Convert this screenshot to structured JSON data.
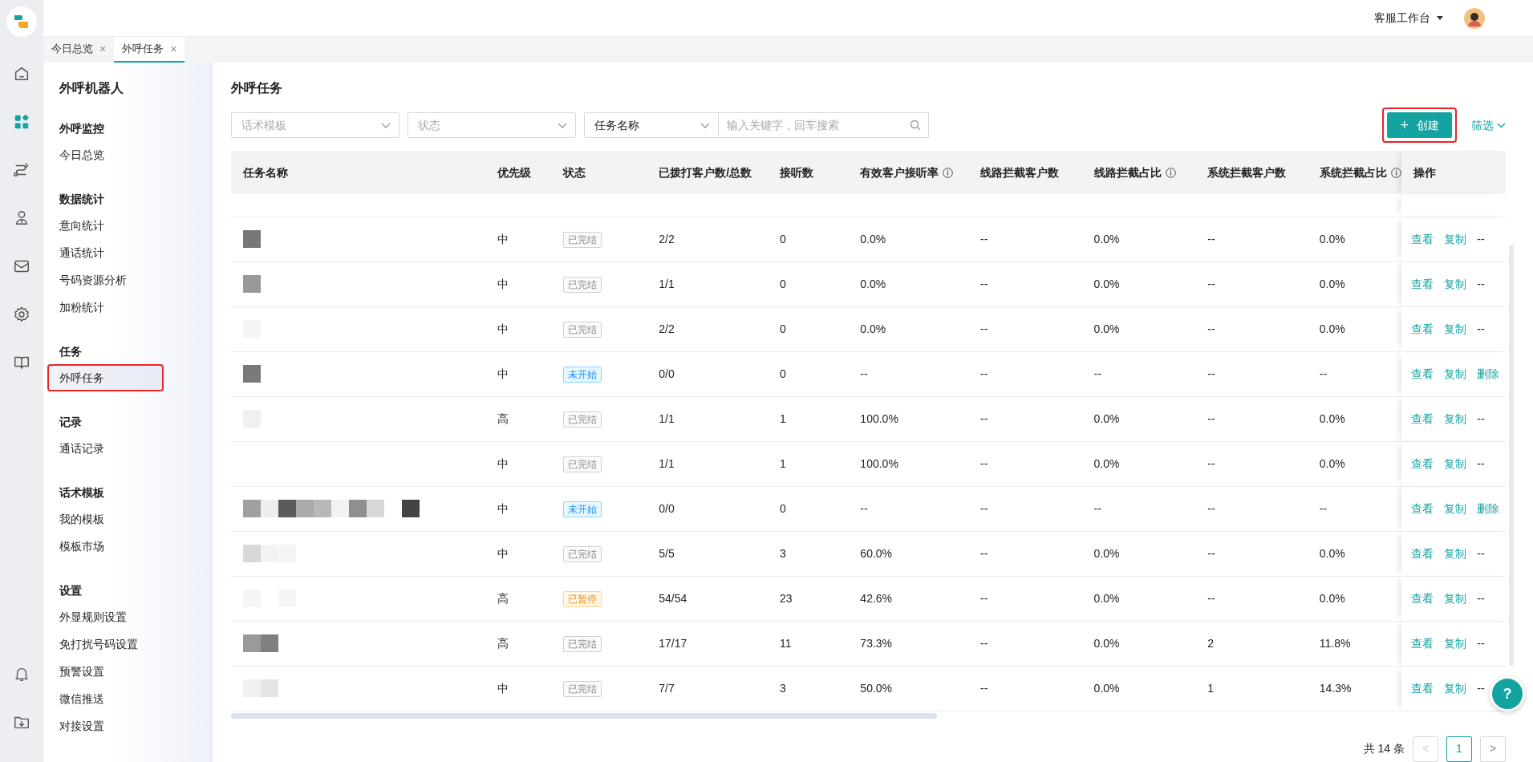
{
  "rail": {
    "icons": [
      {
        "kind": "home",
        "selected": false
      },
      {
        "kind": "apps",
        "selected": true
      },
      {
        "kind": "flow",
        "selected": false
      },
      {
        "kind": "person",
        "selected": false
      },
      {
        "kind": "mail",
        "selected": false
      },
      {
        "kind": "gear",
        "selected": false
      },
      {
        "kind": "book",
        "selected": false
      }
    ],
    "bottom_icons": [
      {
        "kind": "bell",
        "selected": false
      },
      {
        "kind": "download",
        "selected": false
      }
    ]
  },
  "topbar": {
    "workspace": "客服工作台"
  },
  "tabs": [
    {
      "label": "今日总览",
      "close": "×",
      "selected": false
    },
    {
      "label": "外呼任务",
      "close": "×",
      "selected": true
    }
  ],
  "sidebar": {
    "title": "外呼机器人",
    "groups": [
      {
        "label": "外呼监控",
        "items": [
          {
            "label": "今日总览",
            "selected": false,
            "highlighted": false
          }
        ]
      },
      {
        "label": "数据统计",
        "items": [
          {
            "label": "意向统计",
            "selected": false,
            "highlighted": false
          },
          {
            "label": "通话统计",
            "selected": false,
            "highlighted": false
          },
          {
            "label": "号码资源分析",
            "selected": false,
            "highlighted": false
          },
          {
            "label": "加粉统计",
            "selected": false,
            "highlighted": false
          }
        ]
      },
      {
        "label": "任务",
        "items": [
          {
            "label": "外呼任务",
            "selected": true,
            "highlighted": true
          }
        ]
      },
      {
        "label": "记录",
        "items": [
          {
            "label": "通话记录",
            "selected": false,
            "highlighted": false
          }
        ]
      },
      {
        "label": "话术模板",
        "items": [
          {
            "label": "我的模板",
            "selected": false,
            "highlighted": false
          },
          {
            "label": "模板市场",
            "selected": false,
            "highlighted": false
          }
        ]
      },
      {
        "label": "设置",
        "items": [
          {
            "label": "外显规则设置",
            "selected": false,
            "highlighted": false
          },
          {
            "label": "免打扰号码设置",
            "selected": false,
            "highlighted": false
          },
          {
            "label": "预警设置",
            "selected": false,
            "highlighted": false
          },
          {
            "label": "微信推送",
            "selected": false,
            "highlighted": false
          },
          {
            "label": "对接设置",
            "selected": false,
            "highlighted": false
          }
        ]
      }
    ]
  },
  "page": {
    "title": "外呼任务"
  },
  "filters": {
    "template": {
      "placeholder": "话术模板"
    },
    "status": {
      "placeholder": "状态"
    },
    "field": {
      "value": "任务名称"
    },
    "search": {
      "placeholder": "输入关键字，回车搜索"
    }
  },
  "create_button": {
    "label": "创建",
    "icon": "+",
    "highlighted": true
  },
  "filter_link": {
    "label": "筛选"
  },
  "table": {
    "columns": [
      {
        "label": "任务名称",
        "info": false
      },
      {
        "label": "优先级",
        "info": false
      },
      {
        "label": "状态",
        "info": false
      },
      {
        "label": "已拨打客户数/总数",
        "info": false
      },
      {
        "label": "接听数",
        "info": false
      },
      {
        "label": "有效客户接听率",
        "info": true
      },
      {
        "label": "线路拦截客户数",
        "info": false
      },
      {
        "label": "线路拦截占比",
        "info": true
      },
      {
        "label": "系统拦截客户数",
        "info": false
      },
      {
        "label": "系统拦截占比",
        "info": true
      },
      {
        "label": "操作",
        "info": false
      }
    ],
    "rows": [
      {
        "priority": "中",
        "status": {
          "label": "已完结",
          "kind": "done"
        },
        "dialed": "2/2",
        "answered": "0",
        "rate": "0.0%",
        "line_blocked": "--",
        "line_ratio": "0.0%",
        "sys_blocked": "--",
        "sys_ratio": "0.0%",
        "actions": [
          {
            "label": "查看",
            "kind": "link"
          },
          {
            "label": "复制",
            "kind": "link"
          },
          {
            "label": "--",
            "kind": "text"
          }
        ]
      },
      {
        "priority": "中",
        "status": {
          "label": "已完结",
          "kind": "done"
        },
        "dialed": "1/1",
        "answered": "0",
        "rate": "0.0%",
        "line_blocked": "--",
        "line_ratio": "0.0%",
        "sys_blocked": "--",
        "sys_ratio": "0.0%",
        "actions": [
          {
            "label": "查看",
            "kind": "link"
          },
          {
            "label": "复制",
            "kind": "link"
          },
          {
            "label": "--",
            "kind": "text"
          }
        ]
      },
      {
        "priority": "中",
        "status": {
          "label": "已完结",
          "kind": "done"
        },
        "dialed": "2/2",
        "answered": "0",
        "rate": "0.0%",
        "line_blocked": "--",
        "line_ratio": "0.0%",
        "sys_blocked": "--",
        "sys_ratio": "0.0%",
        "actions": [
          {
            "label": "查看",
            "kind": "link"
          },
          {
            "label": "复制",
            "kind": "link"
          },
          {
            "label": "--",
            "kind": "text"
          }
        ]
      },
      {
        "priority": "中",
        "status": {
          "label": "未开始",
          "kind": "pending"
        },
        "dialed": "0/0",
        "answered": "0",
        "rate": "--",
        "line_blocked": "--",
        "line_ratio": "--",
        "sys_blocked": "--",
        "sys_ratio": "--",
        "actions": [
          {
            "label": "查看",
            "kind": "link"
          },
          {
            "label": "复制",
            "kind": "link"
          },
          {
            "label": "删除",
            "kind": "link"
          }
        ]
      },
      {
        "priority": "高",
        "status": {
          "label": "已完结",
          "kind": "done"
        },
        "dialed": "1/1",
        "answered": "1",
        "rate": "100.0%",
        "line_blocked": "--",
        "line_ratio": "0.0%",
        "sys_blocked": "--",
        "sys_ratio": "0.0%",
        "actions": [
          {
            "label": "查看",
            "kind": "link"
          },
          {
            "label": "复制",
            "kind": "link"
          },
          {
            "label": "--",
            "kind": "text"
          }
        ]
      },
      {
        "priority": "中",
        "status": {
          "label": "已完结",
          "kind": "done"
        },
        "dialed": "1/1",
        "answered": "1",
        "rate": "100.0%",
        "line_blocked": "--",
        "line_ratio": "0.0%",
        "sys_blocked": "--",
        "sys_ratio": "0.0%",
        "actions": [
          {
            "label": "查看",
            "kind": "link"
          },
          {
            "label": "复制",
            "kind": "link"
          },
          {
            "label": "--",
            "kind": "text"
          }
        ]
      },
      {
        "priority": "中",
        "status": {
          "label": "未开始",
          "kind": "pending"
        },
        "dialed": "0/0",
        "answered": "0",
        "rate": "--",
        "line_blocked": "--",
        "line_ratio": "--",
        "sys_blocked": "--",
        "sys_ratio": "--",
        "actions": [
          {
            "label": "查看",
            "kind": "link"
          },
          {
            "label": "复制",
            "kind": "link"
          },
          {
            "label": "删除",
            "kind": "link"
          }
        ]
      },
      {
        "priority": "中",
        "status": {
          "label": "已完结",
          "kind": "done"
        },
        "dialed": "5/5",
        "answered": "3",
        "rate": "60.0%",
        "line_blocked": "--",
        "line_ratio": "0.0%",
        "sys_blocked": "--",
        "sys_ratio": "0.0%",
        "actions": [
          {
            "label": "查看",
            "kind": "link"
          },
          {
            "label": "复制",
            "kind": "link"
          },
          {
            "label": "--",
            "kind": "text"
          }
        ]
      },
      {
        "priority": "高",
        "status": {
          "label": "已暂停",
          "kind": "paused"
        },
        "dialed": "54/54",
        "answered": "23",
        "rate": "42.6%",
        "line_blocked": "--",
        "line_ratio": "0.0%",
        "sys_blocked": "--",
        "sys_ratio": "0.0%",
        "actions": [
          {
            "label": "查看",
            "kind": "link"
          },
          {
            "label": "复制",
            "kind": "link"
          },
          {
            "label": "--",
            "kind": "text"
          }
        ]
      },
      {
        "priority": "高",
        "status": {
          "label": "已完结",
          "kind": "done"
        },
        "dialed": "17/17",
        "answered": "11",
        "rate": "73.3%",
        "line_blocked": "--",
        "line_ratio": "0.0%",
        "sys_blocked": "2",
        "sys_ratio": "11.8%",
        "actions": [
          {
            "label": "查看",
            "kind": "link"
          },
          {
            "label": "复制",
            "kind": "link"
          },
          {
            "label": "--",
            "kind": "text"
          }
        ]
      },
      {
        "priority": "中",
        "status": {
          "label": "已完结",
          "kind": "done"
        },
        "dialed": "7/7",
        "answered": "3",
        "rate": "50.0%",
        "line_blocked": "--",
        "line_ratio": "0.0%",
        "sys_blocked": "1",
        "sys_ratio": "14.3%",
        "actions": [
          {
            "label": "查看",
            "kind": "link"
          },
          {
            "label": "复制",
            "kind": "link"
          },
          {
            "label": "--",
            "kind": "text"
          }
        ]
      }
    ]
  },
  "pagination": {
    "total": "共 14 条",
    "prev": "<",
    "next": ">",
    "pages": [
      {
        "label": "1",
        "selected": true
      }
    ]
  },
  "help_button": {
    "label": "?"
  }
}
